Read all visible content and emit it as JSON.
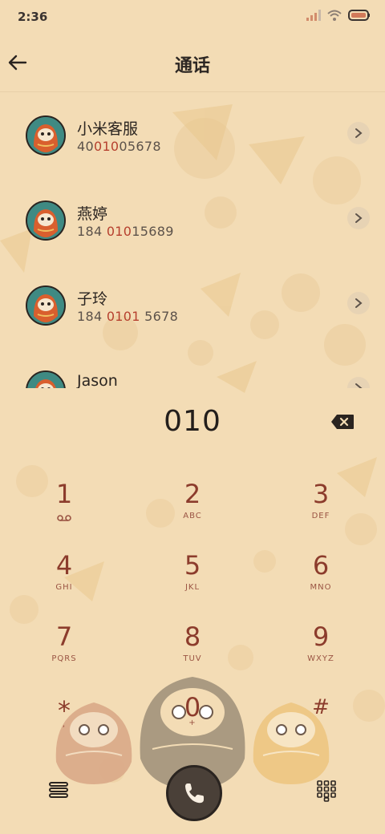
{
  "status": {
    "time": "2:36"
  },
  "header": {
    "title": "通话"
  },
  "contacts": [
    {
      "name": "小米客服",
      "num_pre": "40",
      "num_hl": "010",
      "num_post": "05678"
    },
    {
      "name": "燕婷",
      "num_pre": "184 ",
      "num_hl": "010",
      "num_post": "15689"
    },
    {
      "name": "子玲",
      "num_pre": "184 ",
      "num_hl": "0101",
      "num_post": " 5678"
    },
    {
      "name": "Jason",
      "num_pre": "",
      "num_hl": "",
      "num_post": ""
    }
  ],
  "dialer": {
    "number": "010"
  },
  "keys": [
    {
      "digit": "1",
      "letters": ""
    },
    {
      "digit": "2",
      "letters": "ABC"
    },
    {
      "digit": "3",
      "letters": "DEF"
    },
    {
      "digit": "4",
      "letters": "GHI"
    },
    {
      "digit": "5",
      "letters": "JKL"
    },
    {
      "digit": "6",
      "letters": "MNO"
    },
    {
      "digit": "7",
      "letters": "PQRS"
    },
    {
      "digit": "8",
      "letters": "TUV"
    },
    {
      "digit": "9",
      "letters": "WXYZ"
    },
    {
      "digit": "*",
      "letters": ","
    },
    {
      "digit": "0",
      "letters": "+"
    },
    {
      "digit": "#",
      "letters": ""
    }
  ],
  "icons": {
    "back": "arrow-left-icon",
    "chevron": "chevron-right-icon",
    "voicemail": "voicemail-icon",
    "backspace": "backspace-icon",
    "menu": "menu-icon",
    "call": "phone-icon",
    "keypad": "keypad-icon"
  },
  "colors": {
    "background": "#f3dcb5",
    "digit": "#8c3c2c",
    "highlight": "#b6402e",
    "call_button": "#4a4038"
  }
}
